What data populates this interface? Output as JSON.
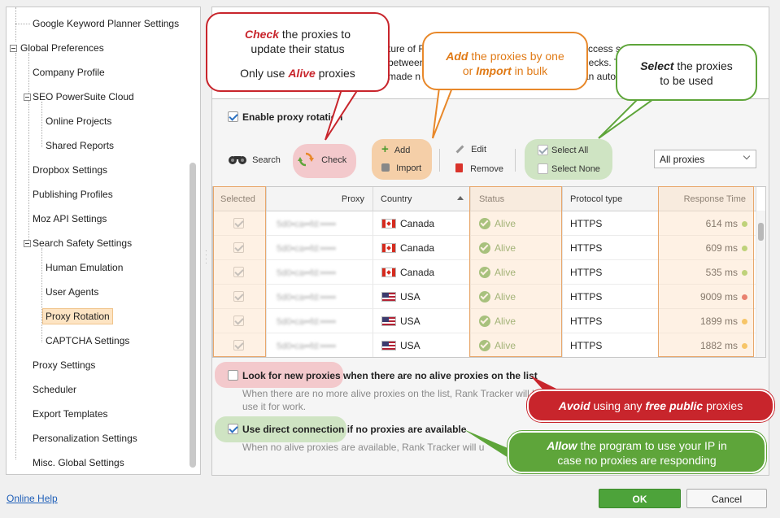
{
  "tree": {
    "items": [
      {
        "label": "Google Keyword Planner Settings"
      },
      {
        "label": "Global Preferences"
      },
      {
        "label": "Company Profile"
      },
      {
        "label": "SEO PowerSuite Cloud"
      },
      {
        "label": "Online Projects"
      },
      {
        "label": "Shared Reports"
      },
      {
        "label": "Dropbox Settings"
      },
      {
        "label": "Publishing Profiles"
      },
      {
        "label": "Moz API Settings"
      },
      {
        "label": "Search Safety Settings"
      },
      {
        "label": "Human Emulation"
      },
      {
        "label": "User Agents"
      },
      {
        "label": "Proxy Rotation",
        "selected": true
      },
      {
        "label": "CAPTCHA Settings"
      },
      {
        "label": "Proxy Settings"
      },
      {
        "label": "Scheduler"
      },
      {
        "label": "Export Templates"
      },
      {
        "label": "Personalization Settings"
      },
      {
        "label": "Misc. Global Settings"
      }
    ]
  },
  "description": {
    "line1a": "ture of R",
    "line1b": "ccess s",
    "line2a": "between",
    "line2b": "hecks. T",
    "line3a": "made n",
    "line3b": "an auto"
  },
  "rotation": {
    "label": "Enable proxy rotation",
    "checked": true
  },
  "toolbar": {
    "search": "Search",
    "check": "Check",
    "add": "Add",
    "import": "Import",
    "edit": "Edit",
    "remove": "Remove",
    "select_all": "Select All",
    "select_none": "Select None",
    "filter_value": "All proxies"
  },
  "table": {
    "columns": [
      "Selected",
      "Proxy",
      "Country",
      "Status",
      "Protocol type",
      "Response Time"
    ],
    "rows": [
      {
        "proxy": "5d0•ca••fd:•••••",
        "country": "Canada",
        "flag": "ca",
        "status": "Alive",
        "protocol": "HTTPS",
        "response": "614 ms",
        "dot_color": "#8cc63f"
      },
      {
        "proxy": "5d0•ca••fd:•••••",
        "country": "Canada",
        "flag": "ca",
        "status": "Alive",
        "protocol": "HTTPS",
        "response": "609 ms",
        "dot_color": "#8cc63f"
      },
      {
        "proxy": "5d0•ca••fd:•••••",
        "country": "Canada",
        "flag": "ca",
        "status": "Alive",
        "protocol": "HTTPS",
        "response": "535 ms",
        "dot_color": "#8cc63f"
      },
      {
        "proxy": "5d0•ca••fd:•••••",
        "country": "USA",
        "flag": "us",
        "status": "Alive",
        "protocol": "HTTPS",
        "response": "9009 ms",
        "dot_color": "#d9332b"
      },
      {
        "proxy": "5d0•ca••fd:•••••",
        "country": "USA",
        "flag": "us",
        "status": "Alive",
        "protocol": "HTTPS",
        "response": "1899 ms",
        "dot_color": "#f2b01e"
      },
      {
        "proxy": "5d0•ca••fd:•••••",
        "country": "USA",
        "flag": "us",
        "status": "Alive",
        "protocol": "HTTPS",
        "response": "1882 ms",
        "dot_color": "#f2b01e"
      }
    ]
  },
  "options": {
    "look_new": {
      "bold": "Look for new proxies",
      "rest": " when there are no alive proxies on the list",
      "checked": false
    },
    "look_new_hint1": "When there are no more alive proxies on the list, Rank Tracker will l",
    "look_new_hint2": "use it for work.",
    "direct": {
      "bold": "Use direct connection",
      "rest": " if no proxies are available",
      "checked": true
    },
    "direct_hint": "When no alive proxies are available, Rank Tracker will u"
  },
  "callouts": {
    "check": {
      "em": "Check",
      "t1": " the proxies to",
      "t2": "update their status",
      "t3": "Only use ",
      "em2": "Alive",
      "t4": " proxies"
    },
    "add": {
      "em": "Add",
      "t1": " the proxies by one",
      "t2": "or ",
      "em2": "Import",
      "t3": " in bulk"
    },
    "select": {
      "em": "Select",
      "t1": " the proxies",
      "t2": "to be used"
    },
    "avoid": {
      "em": "Avoid",
      "t1": " using any ",
      "em2": "free public",
      "t2": " proxies"
    },
    "allow": {
      "em": "Allow",
      "t1": " the program to use your IP in",
      "t2": "case no proxies are responding"
    }
  },
  "footer": {
    "help": "Online Help",
    "ok": "OK",
    "cancel": "Cancel"
  }
}
